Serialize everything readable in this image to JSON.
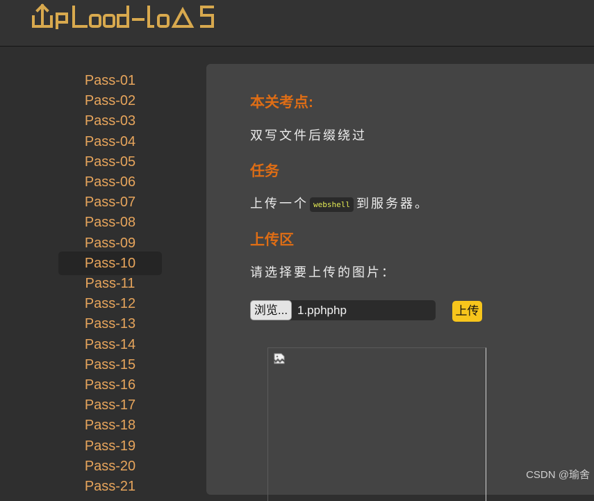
{
  "header": {
    "logo_text": "UpLoad-labs"
  },
  "sidebar": {
    "items": [
      {
        "label": "Pass-01"
      },
      {
        "label": "Pass-02"
      },
      {
        "label": "Pass-03"
      },
      {
        "label": "Pass-04"
      },
      {
        "label": "Pass-05"
      },
      {
        "label": "Pass-06"
      },
      {
        "label": "Pass-07"
      },
      {
        "label": "Pass-08"
      },
      {
        "label": "Pass-09"
      },
      {
        "label": "Pass-10"
      },
      {
        "label": "Pass-11"
      },
      {
        "label": "Pass-12"
      },
      {
        "label": "Pass-13"
      },
      {
        "label": "Pass-14"
      },
      {
        "label": "Pass-15"
      },
      {
        "label": "Pass-16"
      },
      {
        "label": "Pass-17"
      },
      {
        "label": "Pass-18"
      },
      {
        "label": "Pass-19"
      },
      {
        "label": "Pass-20"
      },
      {
        "label": "Pass-21"
      }
    ],
    "active_label": "Pass-10"
  },
  "main": {
    "test_point_title": "本关考点:",
    "test_point_text": "双写文件后缀绕过",
    "task_title": "任务",
    "task_text_before": "上传一个",
    "task_code": "webshell",
    "task_text_after": "到服务器。",
    "upload_area_title": "上传区",
    "upload_prompt": "请选择要上传的图片：",
    "browse_label": "浏览...",
    "file_name": "1.pphphp",
    "upload_label": "上传",
    "preview_icon": "broken-image-icon"
  },
  "watermark": "CSDN @瑜舍",
  "colors": {
    "nav_link": "#e7a55c",
    "section_title": "#de6d15",
    "upload_button": "#f7c51c",
    "code_text": "#e3ea54",
    "logo": "#d8a94e"
  }
}
